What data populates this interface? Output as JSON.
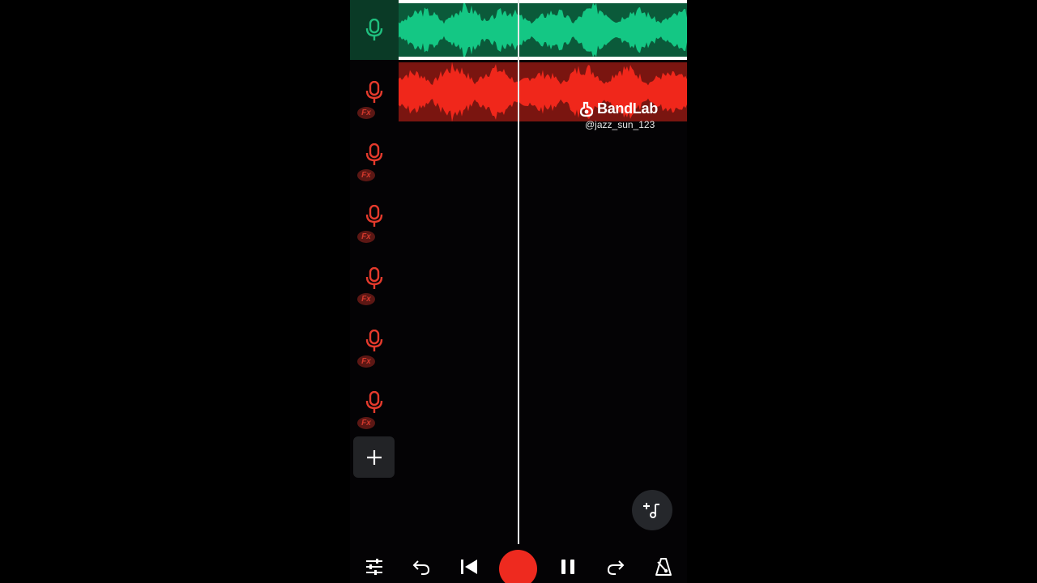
{
  "watermark": {
    "brand": "BandLab",
    "user": "@jazz_sun_123"
  },
  "tracks": [
    {
      "icon": "microphone-icon",
      "color": "#1fbf7e",
      "selected": true,
      "fx": ""
    },
    {
      "icon": "microphone-icon",
      "color": "#e43a2c",
      "selected": false,
      "fx": "Fx"
    },
    {
      "icon": "microphone-icon",
      "color": "#e43a2c",
      "selected": false,
      "fx": "Fx"
    },
    {
      "icon": "microphone-icon",
      "color": "#e43a2c",
      "selected": false,
      "fx": "Fx"
    },
    {
      "icon": "microphone-icon",
      "color": "#e43a2c",
      "selected": false,
      "fx": "Fx"
    },
    {
      "icon": "microphone-icon",
      "color": "#e43a2c",
      "selected": false,
      "fx": "Fx"
    },
    {
      "icon": "microphone-icon",
      "color": "#e43a2c",
      "selected": false,
      "fx": "Fx"
    }
  ],
  "colors": {
    "green_wave": "#14c784",
    "red_wave": "#f0271b",
    "record": "#ee2a1f"
  },
  "toolbar": [
    "mixer-icon",
    "undo-icon",
    "skip-to-start-icon",
    "record-button",
    "pause-icon",
    "redo-icon",
    "metronome-icon"
  ]
}
